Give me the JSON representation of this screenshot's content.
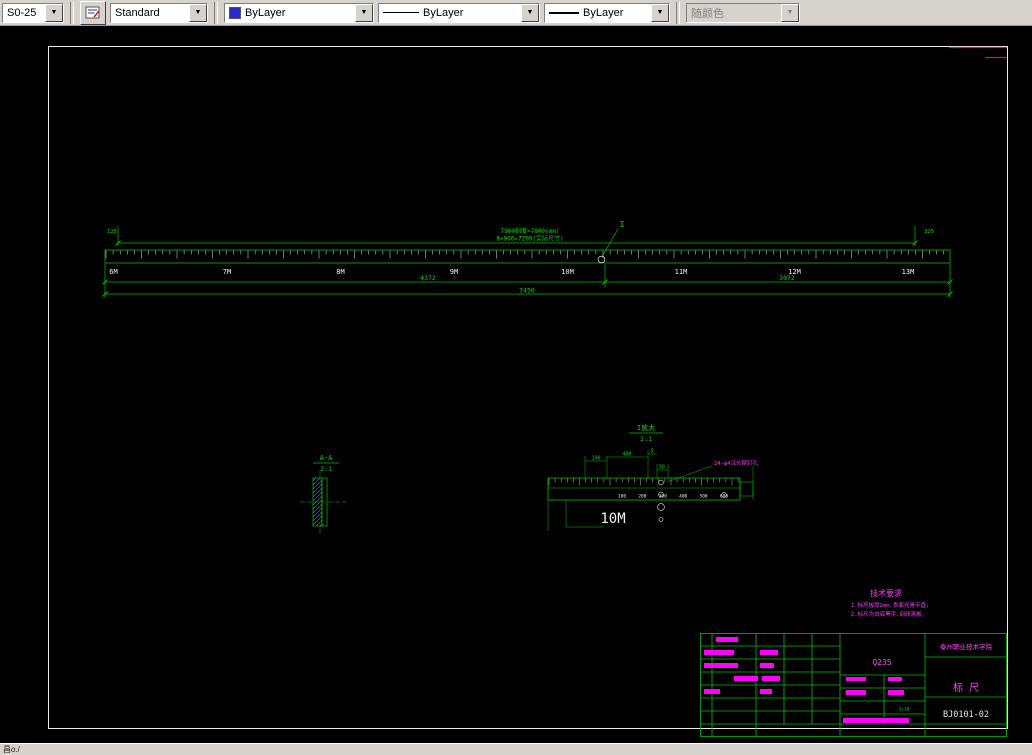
{
  "toolbar": {
    "dim_style": "S0-25",
    "text_style": "Standard",
    "color_value": "ByLayer",
    "linetype_value": "ByLayer",
    "lineweight_value": "ByLayer",
    "plot_style_value": "随颜色",
    "color_swatch": "#2a2ac8"
  },
  "main_ruler": {
    "dim_label_1": "7900刻度=7000(mm)",
    "dim_label_2": "8×900=7200(实际尺寸)",
    "left_end_label": "125",
    "right_end_label": "325",
    "tick_labels": [
      "6M",
      "7M",
      "8M",
      "9M",
      "10M",
      "11M",
      "12M",
      "13M"
    ],
    "dim_left": "4372",
    "dim_right": "3072",
    "dim_total": "7450",
    "detail_marker": "I"
  },
  "detail_aa": {
    "title": "A-A",
    "scale": "2:1"
  },
  "detail_i": {
    "title": "I放大",
    "scale": "2:1",
    "dim_190": "190",
    "dim_400": "400",
    "dim_5": "5",
    "dim_58": "58",
    "hole_note": "24-φ4沉头铆钉孔",
    "scale_numbers": [
      "100",
      "200",
      "300",
      "400",
      "500",
      "600"
    ],
    "big_label": "10M"
  },
  "tech_req": {
    "title": "技术要求",
    "line1": "1.标尺板厚2mm,表面光滑平直;",
    "line2": "2.标尺为白底黑字,刻线清晰。"
  },
  "title_block": {
    "material": "Q235",
    "school": "泰州职业技术学院",
    "part_name": "标 尺",
    "drawing_no": "BJ0101-02",
    "scale": "1:10"
  },
  "statusbar": {
    "text": "昌o./"
  }
}
